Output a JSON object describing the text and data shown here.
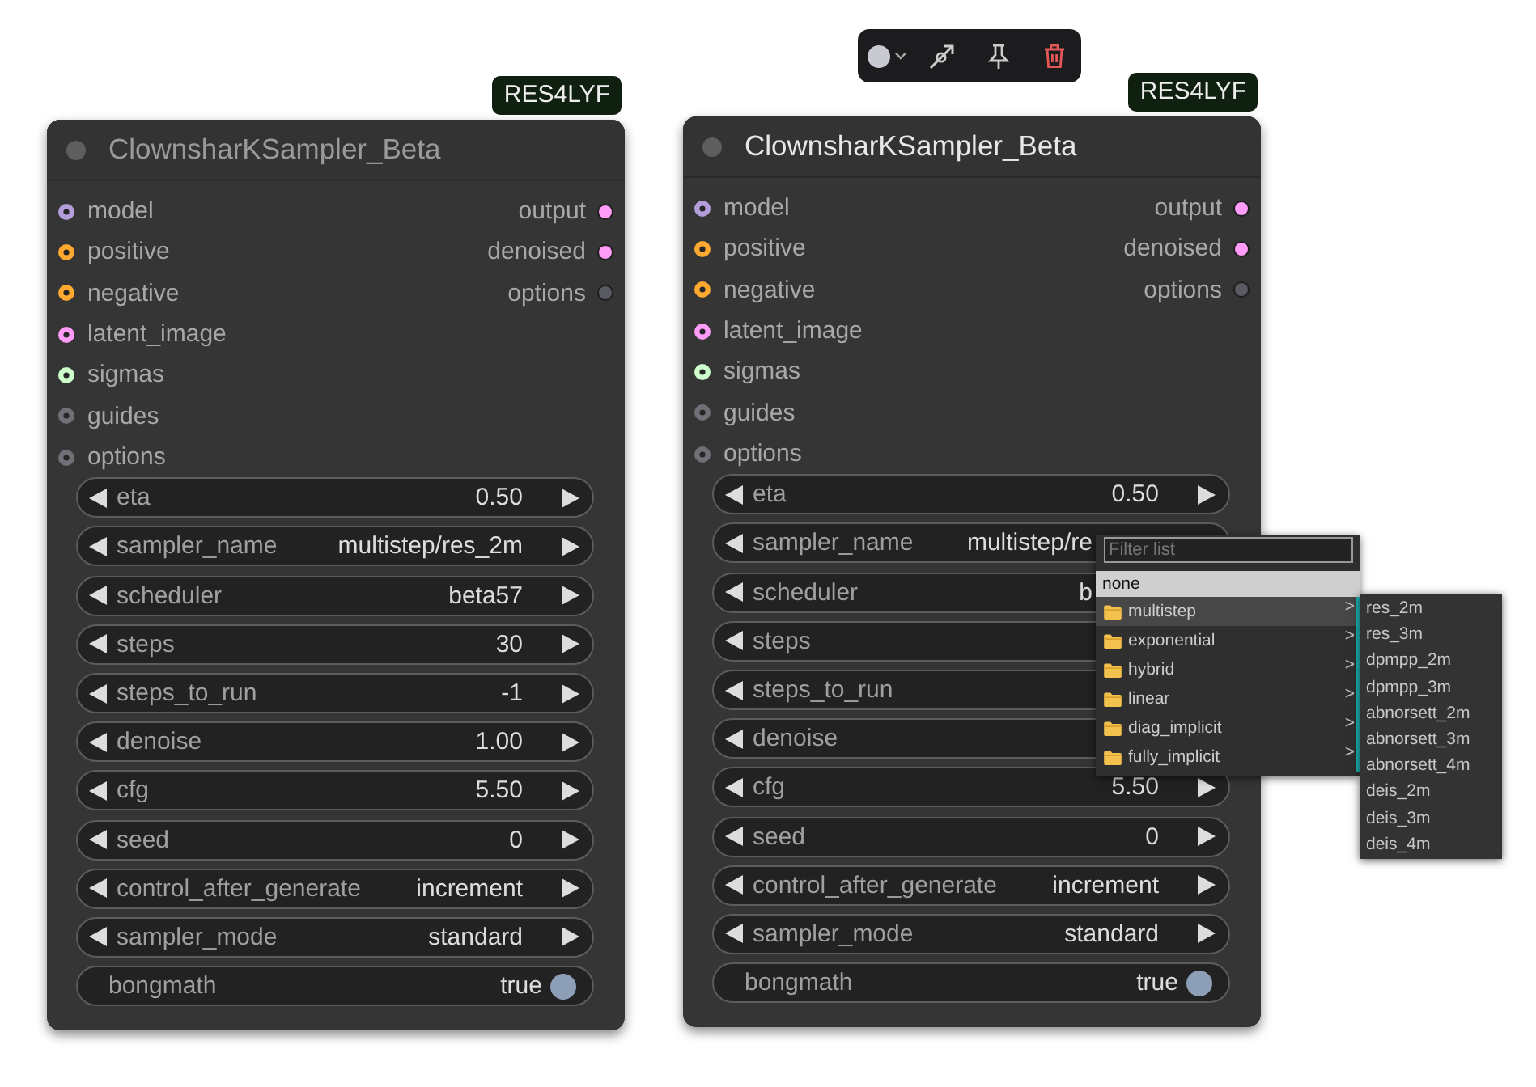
{
  "nodes": [
    {
      "title": "ClownsharKSampler_Beta",
      "badge": "RES4LYF",
      "selected": false,
      "inputs": [
        {
          "label": "model",
          "color": "#b39ddb"
        },
        {
          "label": "positive",
          "color": "#ffa931"
        },
        {
          "label": "negative",
          "color": "#ffa931"
        },
        {
          "label": "latent_image",
          "color": "#ff9cf9"
        },
        {
          "label": "sigmas",
          "color": "#cdffcd"
        },
        {
          "label": "guides",
          "color": "#707078"
        },
        {
          "label": "options",
          "color": "#707078"
        }
      ],
      "outputs": [
        {
          "label": "output",
          "color": "#ff9cf9"
        },
        {
          "label": "denoised",
          "color": "#ff9cf9"
        },
        {
          "label": "options",
          "color": "#5a5a62"
        }
      ],
      "widgets": [
        {
          "kind": "stepper",
          "label": "eta",
          "value": "0.50"
        },
        {
          "kind": "stepper",
          "label": "sampler_name",
          "value": "multistep/res_2m"
        },
        {
          "kind": "stepper",
          "label": "scheduler",
          "value": "beta57"
        },
        {
          "kind": "stepper",
          "label": "steps",
          "value": "30"
        },
        {
          "kind": "stepper",
          "label": "steps_to_run",
          "value": "-1"
        },
        {
          "kind": "stepper",
          "label": "denoise",
          "value": "1.00"
        },
        {
          "kind": "stepper",
          "label": "cfg",
          "value": "5.50"
        },
        {
          "kind": "stepper",
          "label": "seed",
          "value": "0"
        },
        {
          "kind": "stepper",
          "label": "control_after_generate",
          "value": "increment"
        },
        {
          "kind": "stepper",
          "label": "sampler_mode",
          "value": "standard"
        },
        {
          "kind": "toggle",
          "label": "bongmath",
          "value": "true",
          "on": true
        }
      ]
    },
    {
      "title": "ClownsharKSampler_Beta",
      "badge": "RES4LYF",
      "selected": true,
      "inputs": [
        {
          "label": "model",
          "color": "#b39ddb"
        },
        {
          "label": "positive",
          "color": "#ffa931"
        },
        {
          "label": "negative",
          "color": "#ffa931"
        },
        {
          "label": "latent_image",
          "color": "#ff9cf9"
        },
        {
          "label": "sigmas",
          "color": "#cdffcd"
        },
        {
          "label": "guides",
          "color": "#707078"
        },
        {
          "label": "options",
          "color": "#707078"
        }
      ],
      "outputs": [
        {
          "label": "output",
          "color": "#ff9cf9"
        },
        {
          "label": "denoised",
          "color": "#ff9cf9"
        },
        {
          "label": "options",
          "color": "#5a5a62"
        }
      ],
      "widgets": [
        {
          "kind": "stepper",
          "label": "eta",
          "value": "0.50",
          "occluded": false
        },
        {
          "kind": "stepper",
          "label": "sampler_name",
          "value": "multistep/re",
          "occluded": true
        },
        {
          "kind": "stepper",
          "label": "scheduler",
          "value": "b",
          "occluded": true
        },
        {
          "kind": "stepper",
          "label": "steps"
        },
        {
          "kind": "stepper",
          "label": "steps_to_run"
        },
        {
          "kind": "stepper",
          "label": "denoise"
        },
        {
          "kind": "stepper",
          "label": "cfg",
          "value": "5.50",
          "occluded": false
        },
        {
          "kind": "stepper",
          "label": "seed",
          "value": "0",
          "occluded": false
        },
        {
          "kind": "stepper",
          "label": "control_after_generate",
          "value": "increment",
          "occluded": false
        },
        {
          "kind": "stepper",
          "label": "sampler_mode",
          "value": "standard",
          "occluded": false
        },
        {
          "kind": "toggle",
          "label": "bongmath",
          "value": "true",
          "on": true
        }
      ],
      "dropdown": {
        "filter": {
          "placeholder": "Filter list"
        },
        "items": [
          {
            "kind": "option",
            "label": "none",
            "selected": true,
            "expanded": false
          },
          {
            "kind": "folder",
            "label": "multistep",
            "arrow": ">",
            "selected": false,
            "expanded": true
          },
          {
            "kind": "folder",
            "label": "exponential",
            "arrow": ">",
            "selected": false,
            "expanded": false
          },
          {
            "kind": "folder",
            "label": "hybrid",
            "arrow": ">",
            "selected": false,
            "expanded": false
          },
          {
            "kind": "folder",
            "label": "linear",
            "arrow": ">",
            "selected": false,
            "expanded": false
          },
          {
            "kind": "folder",
            "label": "diag_implicit",
            "arrow": ">",
            "selected": false,
            "expanded": false
          },
          {
            "kind": "folder",
            "label": "fully_implicit",
            "arrow": ">",
            "selected": false,
            "expanded": false
          }
        ],
        "submenu": {
          "items": [
            "res_2m",
            "res_3m",
            "dpmpp_2m",
            "dpmpp_3m",
            "abnorsett_2m",
            "abnorsett_3m",
            "abnorsett_4m",
            "deis_2m",
            "deis_3m",
            "deis_4m"
          ]
        }
      }
    }
  ]
}
